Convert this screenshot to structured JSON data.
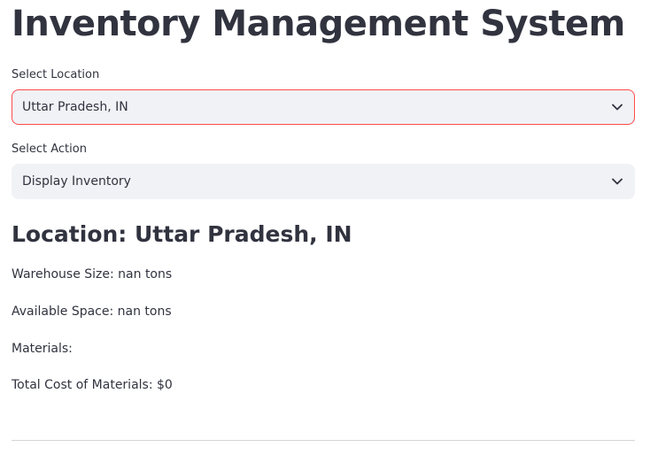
{
  "title": "Inventory Management System",
  "location_select": {
    "label": "Select Location",
    "value": "Uttar Pradesh, IN",
    "chevron_icon": "chevron-down-icon"
  },
  "action_select": {
    "label": "Select Action",
    "value": "Display Inventory",
    "chevron_icon": "chevron-down-icon"
  },
  "details": {
    "heading": "Location: Uttar Pradesh, IN",
    "warehouse_size": "Warehouse Size: nan tons",
    "available_space": "Available Space: nan tons",
    "materials": "Materials:",
    "total_cost": "Total Cost of Materials: $0"
  },
  "colors": {
    "text": "#31333f",
    "select_bg": "#f0f2f6",
    "focus_border": "#ff4b4b"
  }
}
